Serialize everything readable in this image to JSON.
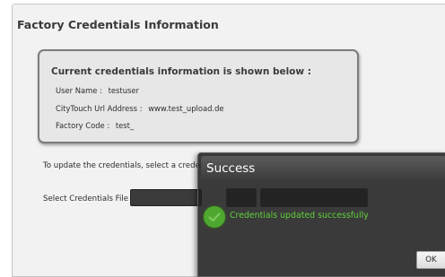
{
  "panel": {
    "title": "Factory Credentials Information"
  },
  "credentials": {
    "heading": "Current credentials information is shown below :",
    "user_name": {
      "label": "User Name :",
      "value": "testuser"
    },
    "citytouch_url": {
      "label": "CityTouch Url Address :",
      "value": "www.test_upload.de"
    },
    "factory_code": {
      "label": "Factory Code :",
      "value": "test_"
    }
  },
  "update": {
    "text_visible": "To update the credentials, select a credentia"
  },
  "file_select": {
    "label": "Select Credentials File :",
    "required_marker": "*"
  },
  "dialog": {
    "title": "Success",
    "message": "Credentials updated successfully",
    "ok_label": "OK",
    "icon": "check-circle-icon"
  },
  "colors": {
    "success_green": "#5fd13a",
    "dialog_background": "#202020",
    "panel_background": "#f2f2f2"
  }
}
